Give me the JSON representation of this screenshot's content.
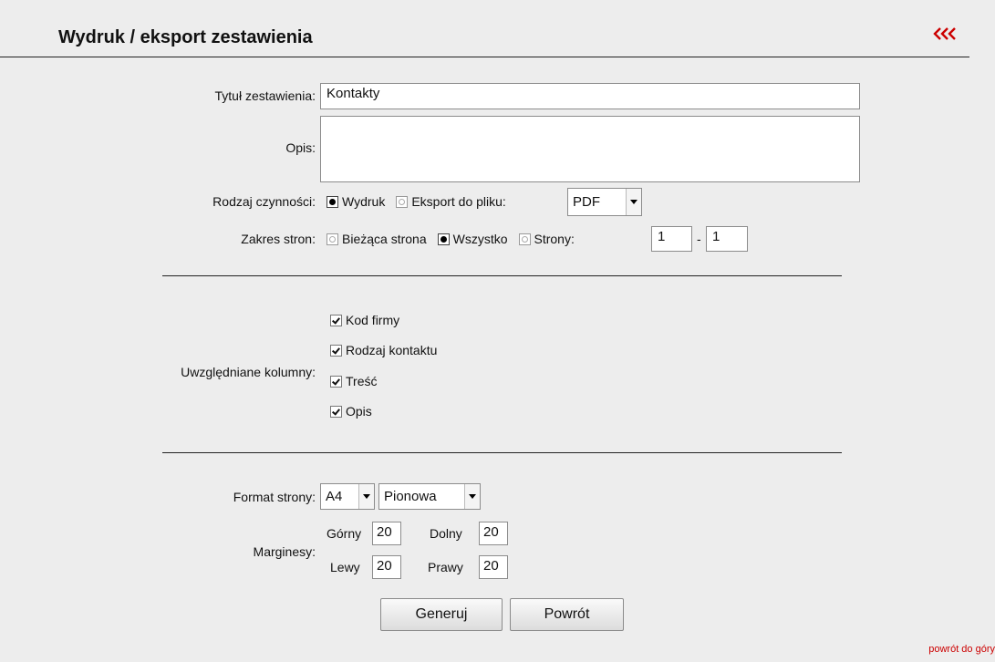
{
  "header": {
    "title": "Wydruk / eksport zestawienia",
    "back_icon": "triple-chevron-left-icon",
    "accent_color": "#cc0000"
  },
  "form": {
    "report_title_label": "Tytuł zestawienia:",
    "report_title_value": "Kontakty",
    "description_label": "Opis:",
    "description_value": "",
    "action_label": "Rodzaj czynności:",
    "action_print_label": "Wydruk",
    "action_export_label": "Eksport do pliku:",
    "action_selected": "Wydruk",
    "export_format_value": "PDF",
    "page_range_label": "Zakres stron:",
    "range_current_label": "Bieżąca strona",
    "range_all_label": "Wszystko",
    "range_pages_label": "Strony:",
    "range_selected": "Wszystko",
    "range_from": "1",
    "range_dash": "-",
    "range_to": "1",
    "columns_label": "Uwzględniane kolumny:",
    "columns": [
      {
        "label": "Kod firmy",
        "checked": true
      },
      {
        "label": "Rodzaj kontaktu",
        "checked": true
      },
      {
        "label": "Treść",
        "checked": true
      },
      {
        "label": "Opis",
        "checked": true
      }
    ],
    "page_format_label": "Format strony:",
    "page_size_value": "A4",
    "orientation_value": "Pionowa",
    "margins_label": "Marginesy:",
    "margin_top_label": "Górny",
    "margin_top_value": "20",
    "margin_bottom_label": "Dolny",
    "margin_bottom_value": "20",
    "margin_left_label": "Lewy",
    "margin_left_value": "20",
    "margin_right_label": "Prawy",
    "margin_right_value": "20"
  },
  "buttons": {
    "generate_label": "Generuj",
    "back_label": "Powrót"
  },
  "footer": {
    "back_to_top_label": "powrót do góry"
  }
}
